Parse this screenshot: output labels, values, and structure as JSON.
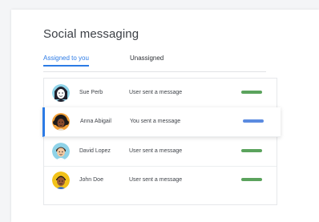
{
  "title": "Social messaging",
  "tabs": [
    {
      "label": "Assigned to you",
      "active": true
    },
    {
      "label": "Unassigned",
      "active": false
    }
  ],
  "colors": {
    "accent": "#2c7be5",
    "status_green": "#5ba35d",
    "status_blue": "#5b8be0"
  },
  "conversations": [
    {
      "name": "Sue Perb",
      "message": "User sent a message",
      "status_color": "#5ba35d",
      "selected": false,
      "avatar_icon": "woman-avatar-icon"
    },
    {
      "name": "Anna Abigail",
      "message": "You sent a message",
      "status_color": "#5b8be0",
      "selected": true,
      "avatar_icon": "woman-curly-hair-avatar-icon"
    },
    {
      "name": "David Lopez",
      "message": "User sent a message",
      "status_color": "#5ba35d",
      "selected": false,
      "avatar_icon": "man-avatar-icon"
    },
    {
      "name": "John Doe",
      "message": "User sent a message",
      "status_color": "#5ba35d",
      "selected": false,
      "avatar_icon": "man-dark-hair-avatar-icon"
    }
  ]
}
